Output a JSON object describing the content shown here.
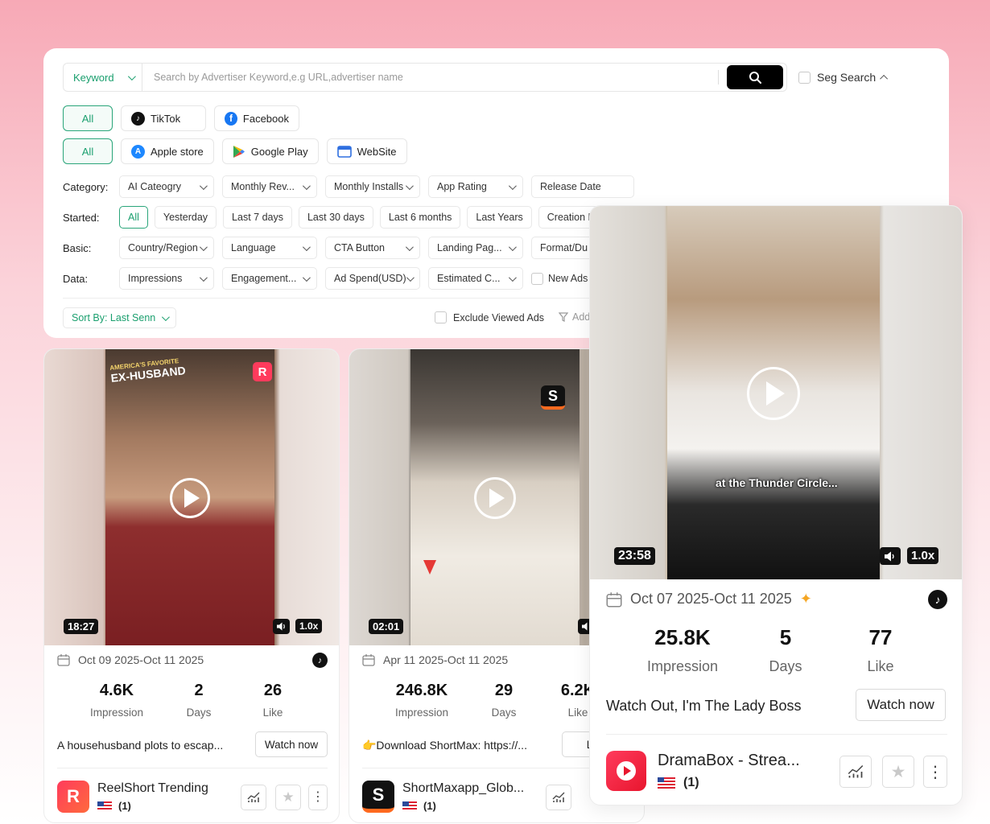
{
  "search": {
    "keyword_label": "Keyword",
    "placeholder": "Search by Advertiser Keyword,e.g URL,advertiser name",
    "seg_search_label": "Seg Search"
  },
  "platforms": {
    "all": "All",
    "tiktok": "TikTok",
    "facebook": "Facebook"
  },
  "stores": {
    "all": "All",
    "apple": "Apple store",
    "google": "Google Play",
    "website": "WebSite"
  },
  "filters": {
    "category": {
      "label": "Category:",
      "items": [
        "AI Cateogry",
        "Monthly Rev...",
        "Monthly Installs",
        "App Rating",
        "Release Date"
      ]
    },
    "started": {
      "label": "Started:",
      "items": [
        "All",
        "Yesterday",
        "Last 7 days",
        "Last 30 days",
        "Last 6 months",
        "Last Years",
        "Creation Dat"
      ]
    },
    "basic": {
      "label": "Basic:",
      "items": [
        "Country/Region",
        "Language",
        "CTA Button",
        "Landing Pag...",
        "Format/Du"
      ]
    },
    "data": {
      "label": "Data:",
      "items": [
        "Impressions",
        "Engagement...",
        "Ad Spend(USD)",
        "Estimated C...",
        "New Ads"
      ]
    }
  },
  "sort": {
    "label": "Sort By: Last Senn"
  },
  "exclude_label": "Exclude Viewed Ads",
  "add_filter_label": "Add",
  "cards": [
    {
      "duration": "18:27",
      "speed": "1.0x",
      "overlay_title_top": "AMERICA'S FAVORITE",
      "overlay_title": "EX-HUSBAND",
      "date_range": "Oct 09 2025-Oct 11 2025",
      "impression": "4.6K",
      "impression_label": "Impression",
      "days": "2",
      "days_label": "Days",
      "like": "26",
      "like_label": "Like",
      "description": "A househusband plots to escap...",
      "cta": "Watch now",
      "app_name": "ReelShort Trending",
      "country_count": "(1)",
      "logo_letter": "R"
    },
    {
      "duration": "02:01",
      "date_range": "Apr 11 2025-Oct 11 2025",
      "impression": "246.8K",
      "impression_label": "Impression",
      "days": "29",
      "days_label": "Days",
      "like": "6.2K",
      "like_label": "Like",
      "description": "👉Download ShortMax: https://...",
      "cta": "Liste",
      "app_name": "ShortMaxapp_Glob...",
      "country_count": "(1)",
      "logo_letter": "S"
    },
    {
      "duration": "23:58",
      "speed": "1.0x",
      "subtitle": "at the Thunder Circle...",
      "date_range": "Oct 07 2025-Oct 11 2025",
      "impression": "25.8K",
      "impression_label": "Impression",
      "days": "5",
      "days_label": "Days",
      "like": "77",
      "like_label": "Like",
      "description": "Watch Out, I'm The Lady Boss",
      "cta": "Watch now",
      "app_name": "DramaBox - Strea...",
      "country_count": "(1)"
    }
  ],
  "colors": {
    "accent": "#1a9f6e",
    "bg_pink": "#f7a9b6"
  }
}
